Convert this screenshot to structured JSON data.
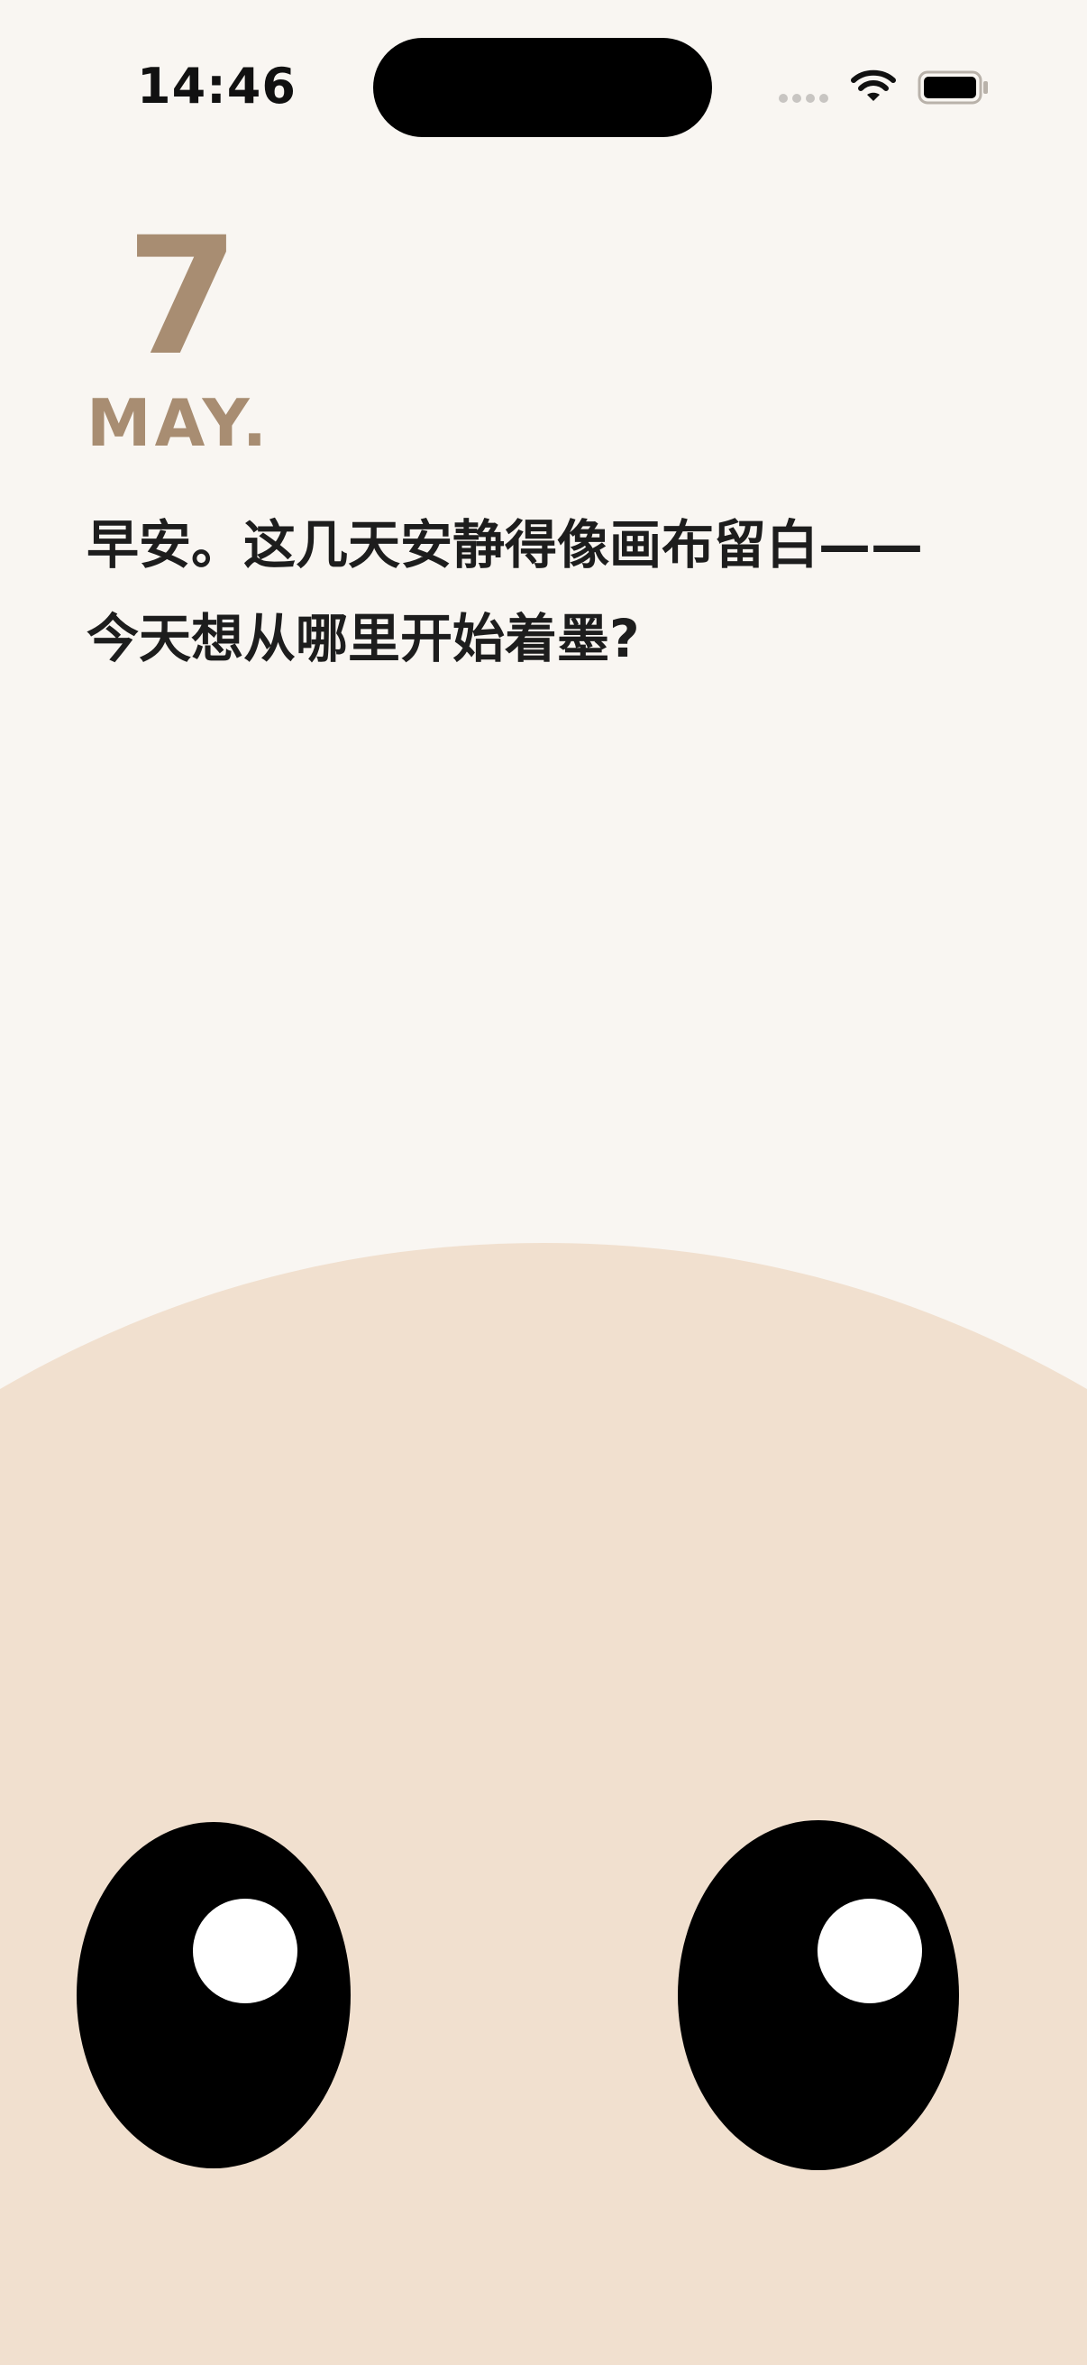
{
  "status_bar": {
    "time": "14:46"
  },
  "date": {
    "day": "7",
    "month": "MAY."
  },
  "message": {
    "line1": "早安。这几天安静得像画布留白——",
    "line2": "今天想从哪里开始着墨?"
  },
  "icons": {
    "signal": "cellular-signal-icon",
    "wifi": "wifi-icon",
    "battery": "battery-icon"
  },
  "colors": {
    "background": "#f9f6f2",
    "accent": "#a88d72",
    "text": "#1d1d1d",
    "face": "#f1e0cf",
    "eye": "#000000",
    "highlight": "#ffffff"
  }
}
